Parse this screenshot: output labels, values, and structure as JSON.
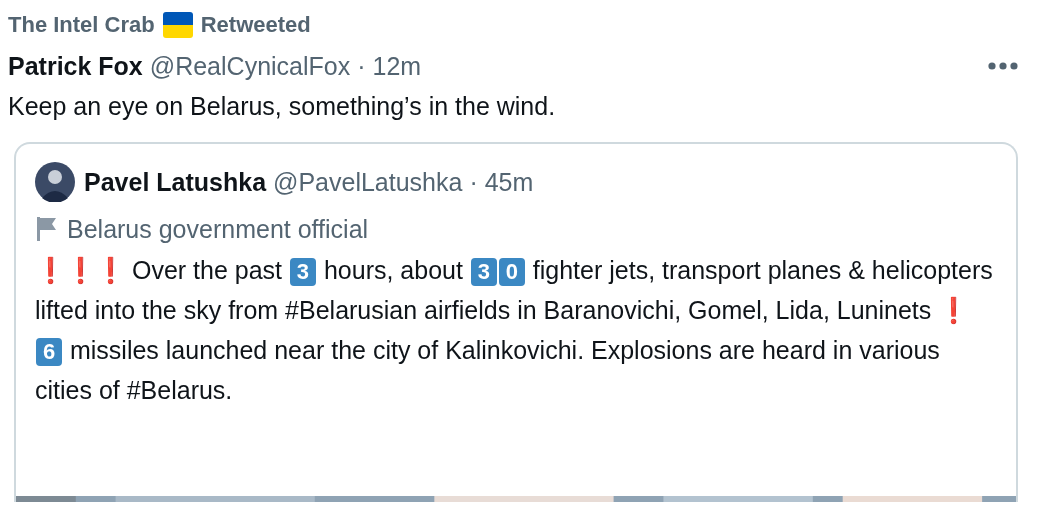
{
  "retweet_header": {
    "retweeter": "The Intel Crab",
    "label": "Retweeted"
  },
  "tweet": {
    "name": "Patrick Fox",
    "handle": "@RealCynicalFox",
    "time": "· 12m",
    "text": "Keep an eye on Belarus, something’s in the wind.",
    "quoted_tweet": {
      "name": "Pavel Latushka",
      "handle": "@PavelLatushka",
      "time": "· 45m",
      "label": "Belarus government official",
      "paragraphs": [
        [
          {
            "kind": "exclaim",
            "text": "❗"
          },
          {
            "kind": "exclaim",
            "text": "❗"
          },
          {
            "kind": "exclaim",
            "text": "❗"
          },
          {
            "kind": "text",
            "text": " Over the past "
          },
          {
            "kind": "keycap",
            "text": "3"
          },
          {
            "kind": "text",
            "text": " hours, about "
          },
          {
            "kind": "keycap",
            "text": "3"
          },
          {
            "kind": "keycap",
            "text": "0"
          },
          {
            "kind": "text",
            "text": " fighter jets, transport planes & helicopters lifted into the sky from #Belarusian airfields in Baranovichi, Gomel, Lida, Luninets "
          },
          {
            "kind": "exclaim",
            "text": "❗"
          }
        ],
        [
          {
            "kind": "keycap",
            "text": "6"
          },
          {
            "kind": "text",
            "text": " missiles launched near the city of Kalinkovichi. Explosions are heard in various cities of #Belarus."
          }
        ]
      ]
    }
  }
}
